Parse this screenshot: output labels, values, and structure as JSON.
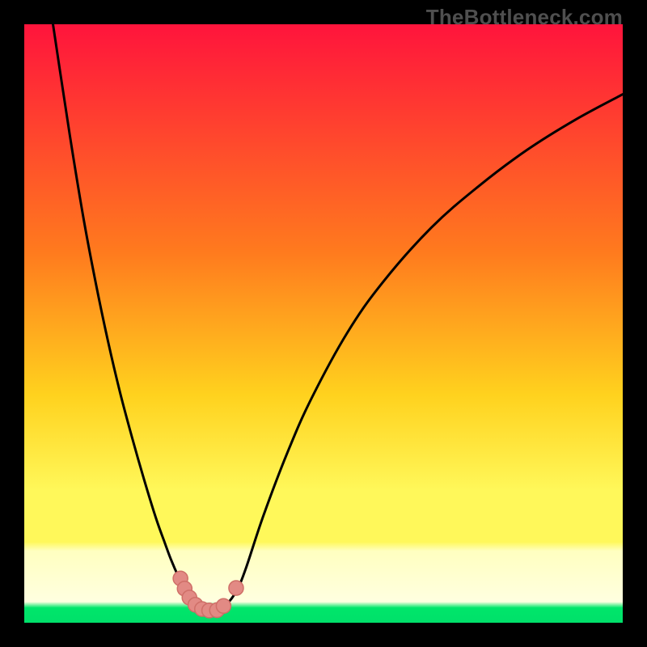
{
  "watermark": "TheBottleneck.com",
  "colors": {
    "frame": "#000000",
    "grad_top": "#ff143c",
    "grad_mid1": "#ff7a1e",
    "grad_mid2": "#ffd21e",
    "grad_mid3": "#fff85a",
    "grad_pale": "#ffffc0",
    "grad_green": "#00e66a",
    "curve": "#000000",
    "marker_fill": "#e28a84",
    "marker_stroke": "#cf6f68"
  },
  "chart_data": {
    "type": "line",
    "title": "",
    "xlabel": "",
    "ylabel": "",
    "xlim": [
      0,
      100
    ],
    "ylim": [
      0,
      100
    ],
    "gradient_stops": [
      {
        "offset": 0,
        "color": "#ff143c"
      },
      {
        "offset": 0.38,
        "color": "#ff7a1e"
      },
      {
        "offset": 0.62,
        "color": "#ffd21e"
      },
      {
        "offset": 0.78,
        "color": "#fff85a"
      },
      {
        "offset": 0.865,
        "color": "#fff85a"
      },
      {
        "offset": 0.88,
        "color": "#ffffc0"
      },
      {
        "offset": 0.965,
        "color": "#ffffe0"
      },
      {
        "offset": 0.975,
        "color": "#00e66a"
      },
      {
        "offset": 1.0,
        "color": "#00e06a"
      }
    ],
    "series": [
      {
        "name": "left-arm",
        "x": [
          4.8,
          6,
          8,
          10,
          12,
          14,
          16,
          18,
          20,
          22,
          23.5,
          24.5,
          25.8,
          27,
          28.5,
          30.0,
          31.5
        ],
        "y": [
          100,
          92,
          79,
          67,
          56.5,
          47,
          38.5,
          31,
          24,
          17.5,
          13.3,
          10.6,
          7.6,
          5.2,
          3.2,
          2.2,
          2.0
        ]
      },
      {
        "name": "right-arm",
        "x": [
          31.5,
          33,
          34.3,
          35.6,
          37,
          40,
          44,
          48,
          54,
          60,
          68,
          76,
          84,
          92,
          100
        ],
        "y": [
          2.0,
          2.4,
          3.6,
          5.6,
          9.0,
          18,
          28.5,
          37.5,
          48.5,
          57,
          66,
          73,
          79,
          84,
          88.3
        ]
      }
    ],
    "markers": [
      {
        "x": 26.1,
        "y": 7.4,
        "r": 1.22
      },
      {
        "x": 26.8,
        "y": 5.7,
        "r": 1.22
      },
      {
        "x": 27.6,
        "y": 4.2,
        "r": 1.22
      },
      {
        "x": 28.6,
        "y": 3.0,
        "r": 1.22
      },
      {
        "x": 29.7,
        "y": 2.3,
        "r": 1.22
      },
      {
        "x": 30.9,
        "y": 2.05,
        "r": 1.22
      },
      {
        "x": 32.2,
        "y": 2.1,
        "r": 1.22
      },
      {
        "x": 33.3,
        "y": 2.8,
        "r": 1.22
      },
      {
        "x": 35.4,
        "y": 5.8,
        "r": 1.22
      }
    ],
    "annotations": []
  }
}
